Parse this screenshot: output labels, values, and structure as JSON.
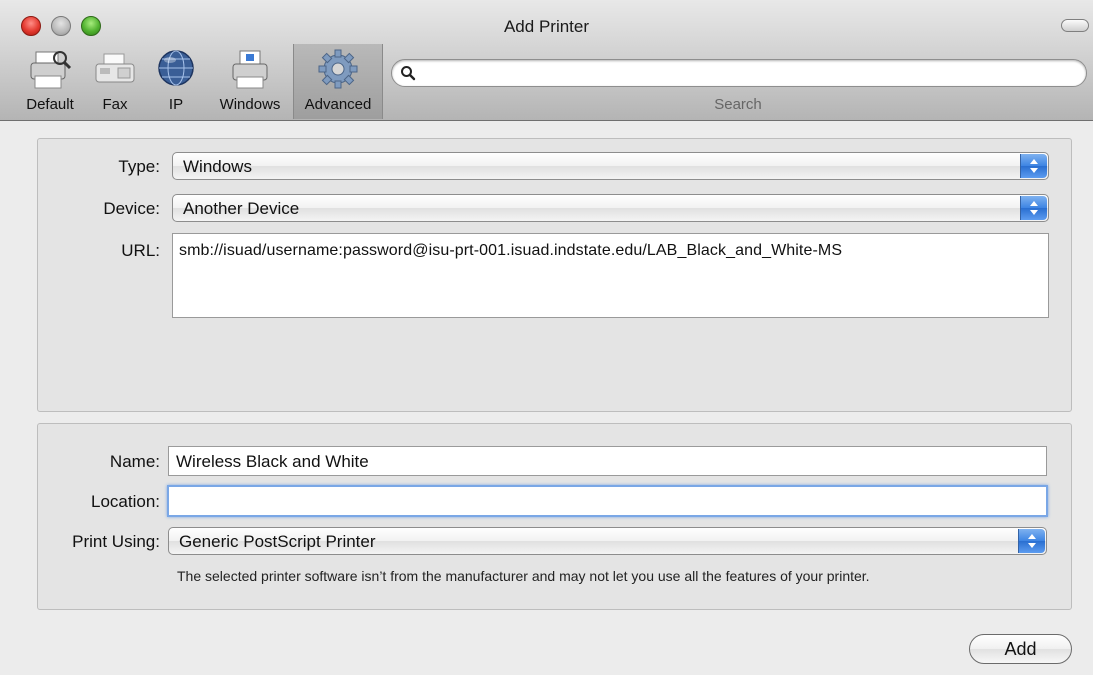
{
  "window": {
    "title": "Add Printer"
  },
  "toolbar": {
    "items": [
      {
        "label": "Default",
        "icon": "default-printer-icon"
      },
      {
        "label": "Fax",
        "icon": "fax-icon"
      },
      {
        "label": "IP",
        "icon": "ip-globe-icon"
      },
      {
        "label": "Windows",
        "icon": "windows-printer-icon"
      },
      {
        "label": "Advanced",
        "icon": "gear-icon",
        "selected": true
      }
    ],
    "search": {
      "value": "",
      "label": "Search"
    }
  },
  "advanced": {
    "type_label": "Type:",
    "type_value": "Windows",
    "device_label": "Device:",
    "device_value": "Another Device",
    "url_label": "URL:",
    "url_value": "smb://isuad/username:password@isu-prt-001.isuad.indstate.edu/LAB_Black_and_White-MS"
  },
  "printer": {
    "name_label": "Name:",
    "name_value": "Wireless Black and White",
    "location_label": "Location:",
    "location_value": "",
    "print_using_label": "Print Using:",
    "print_using_value": "Generic PostScript Printer",
    "note": "The selected printer software isn’t from the manufacturer and may not let you use all the features of your printer."
  },
  "buttons": {
    "add": "Add"
  },
  "colors": {
    "accent": "#3d84e3",
    "focus_ring": "#7aa7e6"
  }
}
